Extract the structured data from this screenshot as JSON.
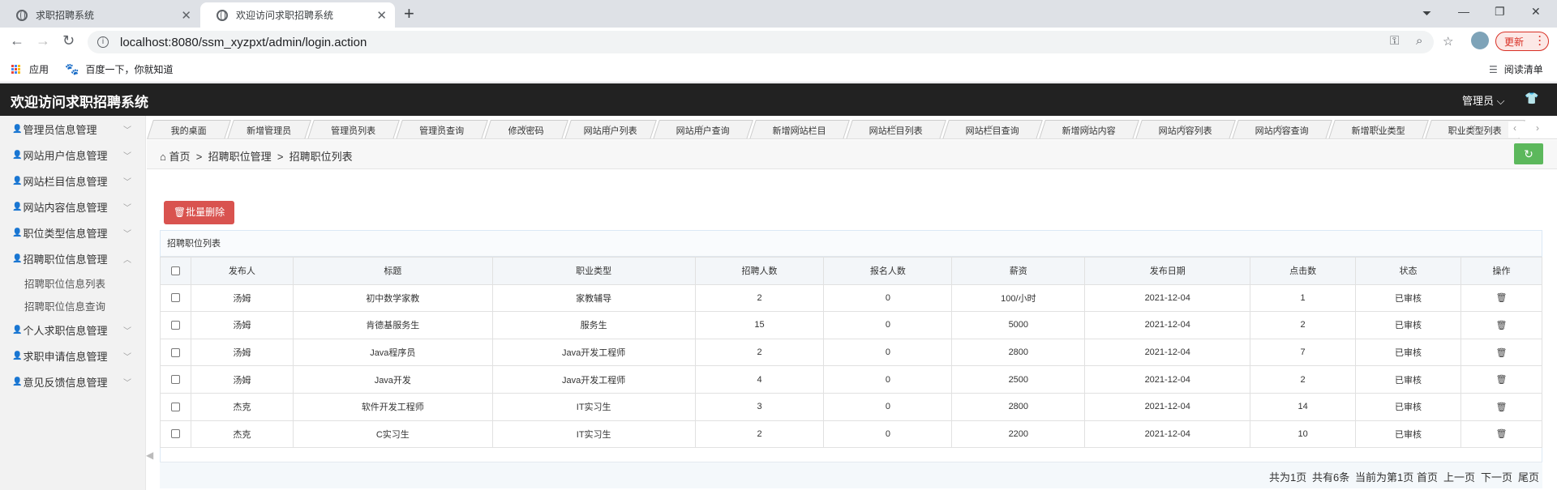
{
  "browser": {
    "tabs": [
      {
        "title": "求职招聘系统",
        "active": false
      },
      {
        "title": "欢迎访问求职招聘系统",
        "active": true
      }
    ],
    "url": "localhost:8080/ssm_xyzpxt/admin/login.action",
    "update_label": "更新",
    "bookmarks": [
      {
        "label": "应用",
        "icon": "apps-grid-icon"
      },
      {
        "label": "百度一下，你就知道",
        "icon": "baidu-paw-icon"
      }
    ],
    "reading_list_label": "阅读清单"
  },
  "header": {
    "title": "欢迎访问求职招聘系统",
    "user_menu": "管理员"
  },
  "sidebar": {
    "items": [
      {
        "label": "管理员信息管理",
        "expanded": false
      },
      {
        "label": "网站用户信息管理",
        "expanded": false
      },
      {
        "label": "网站栏目信息管理",
        "expanded": false
      },
      {
        "label": "网站内容信息管理",
        "expanded": false
      },
      {
        "label": "职位类型信息管理",
        "expanded": false
      },
      {
        "label": "招聘职位信息管理",
        "expanded": true
      },
      {
        "label": "个人求职信息管理",
        "expanded": false
      },
      {
        "label": "求职申请信息管理",
        "expanded": false
      },
      {
        "label": "意见反馈信息管理",
        "expanded": false
      }
    ],
    "subitems": [
      "招聘职位信息列表",
      "招聘职位信息查询"
    ]
  },
  "page_tabs": [
    "我的桌面",
    "新增管理员",
    "管理员列表",
    "管理员查询",
    "修改密码",
    "网站用户列表",
    "网站用户查询",
    "新增网站栏目",
    "网站栏目列表",
    "网站栏目查询",
    "新增网站内容",
    "网站内容列表",
    "网站内容查询",
    "新增职业类型",
    "职业类型列表"
  ],
  "breadcrumb": {
    "home": "首页",
    "level1": "招聘职位管理",
    "level2": "招聘职位列表",
    "sep": ">"
  },
  "bulk_delete_label": "批量删除",
  "panel_title": "招聘职位列表",
  "table": {
    "columns": [
      "发布人",
      "标题",
      "职业类型",
      "招聘人数",
      "报名人数",
      "薪资",
      "发布日期",
      "点击数",
      "状态",
      "操作"
    ],
    "rows": [
      [
        "汤姆",
        "初中数学家教",
        "家教辅导",
        "2",
        "0",
        "100/小时",
        "2021-12-04",
        "1",
        "已审核"
      ],
      [
        "汤姆",
        "肯德基服务生",
        "服务生",
        "15",
        "0",
        "5000",
        "2021-12-04",
        "2",
        "已审核"
      ],
      [
        "汤姆",
        "Java程序员",
        "Java开发工程师",
        "2",
        "0",
        "2800",
        "2021-12-04",
        "7",
        "已审核"
      ],
      [
        "汤姆",
        "Java开发",
        "Java开发工程师",
        "4",
        "0",
        "2500",
        "2021-12-04",
        "2",
        "已审核"
      ],
      [
        "杰克",
        "软件开发工程师",
        "IT实习生",
        "3",
        "0",
        "2800",
        "2021-12-04",
        "14",
        "已审核"
      ],
      [
        "杰克",
        "C实习生",
        "IT实习生",
        "2",
        "0",
        "2200",
        "2021-12-04",
        "10",
        "已审核"
      ]
    ]
  },
  "pager": {
    "total_pages": "共为1页",
    "total_records": "共有6条",
    "current": "当前为第1页",
    "first": "首页",
    "prev": "上一页",
    "next": "下一页",
    "last": "尾页"
  },
  "colors": {
    "header_bg": "#222222",
    "danger": "#d9534f",
    "success": "#5cb85c",
    "sidebar_bg": "#f2f2f2"
  }
}
